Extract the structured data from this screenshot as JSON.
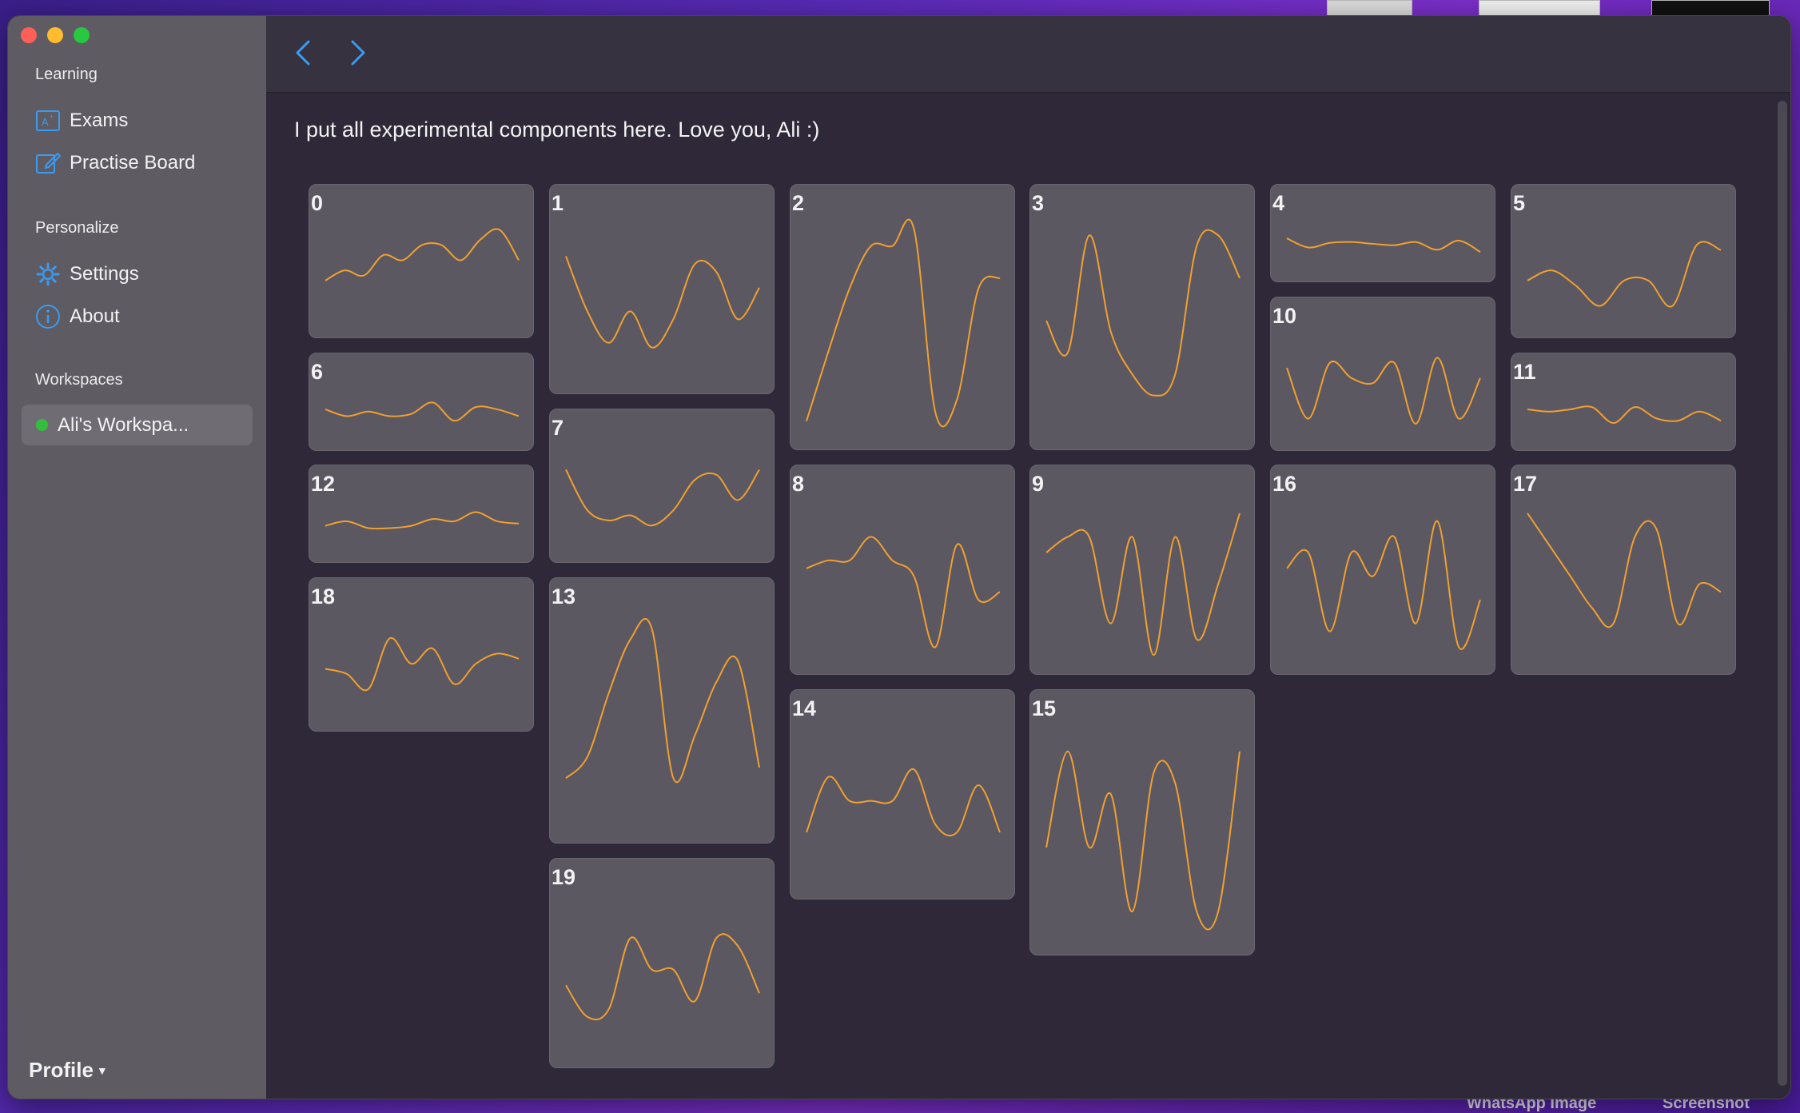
{
  "desktop": {
    "labels": [
      "WhatsApp Image",
      "Screenshot"
    ]
  },
  "sidebar": {
    "section_learning": "Learning",
    "exams_label": "Exams",
    "practise_label": "Practise Board",
    "section_personalize": "Personalize",
    "settings_label": "Settings",
    "about_label": "About",
    "section_workspaces": "Workspaces",
    "workspace_label": "Ali's Workspa...",
    "profile_label": "Profile"
  },
  "main": {
    "intro_text": "I put all experimental components here. Love you, Ali :)",
    "line_color": "#f0a030"
  },
  "tiles": [
    {
      "label": "0"
    },
    {
      "label": "1"
    },
    {
      "label": "2"
    },
    {
      "label": "3"
    },
    {
      "label": "4"
    },
    {
      "label": "5"
    },
    {
      "label": "6"
    },
    {
      "label": "7"
    },
    {
      "label": "8"
    },
    {
      "label": "9"
    },
    {
      "label": "10"
    },
    {
      "label": "11"
    },
    {
      "label": "12"
    },
    {
      "label": "13"
    },
    {
      "label": "14"
    },
    {
      "label": "15"
    },
    {
      "label": "16"
    },
    {
      "label": "17"
    },
    {
      "label": "18"
    },
    {
      "label": "19"
    }
  ]
}
